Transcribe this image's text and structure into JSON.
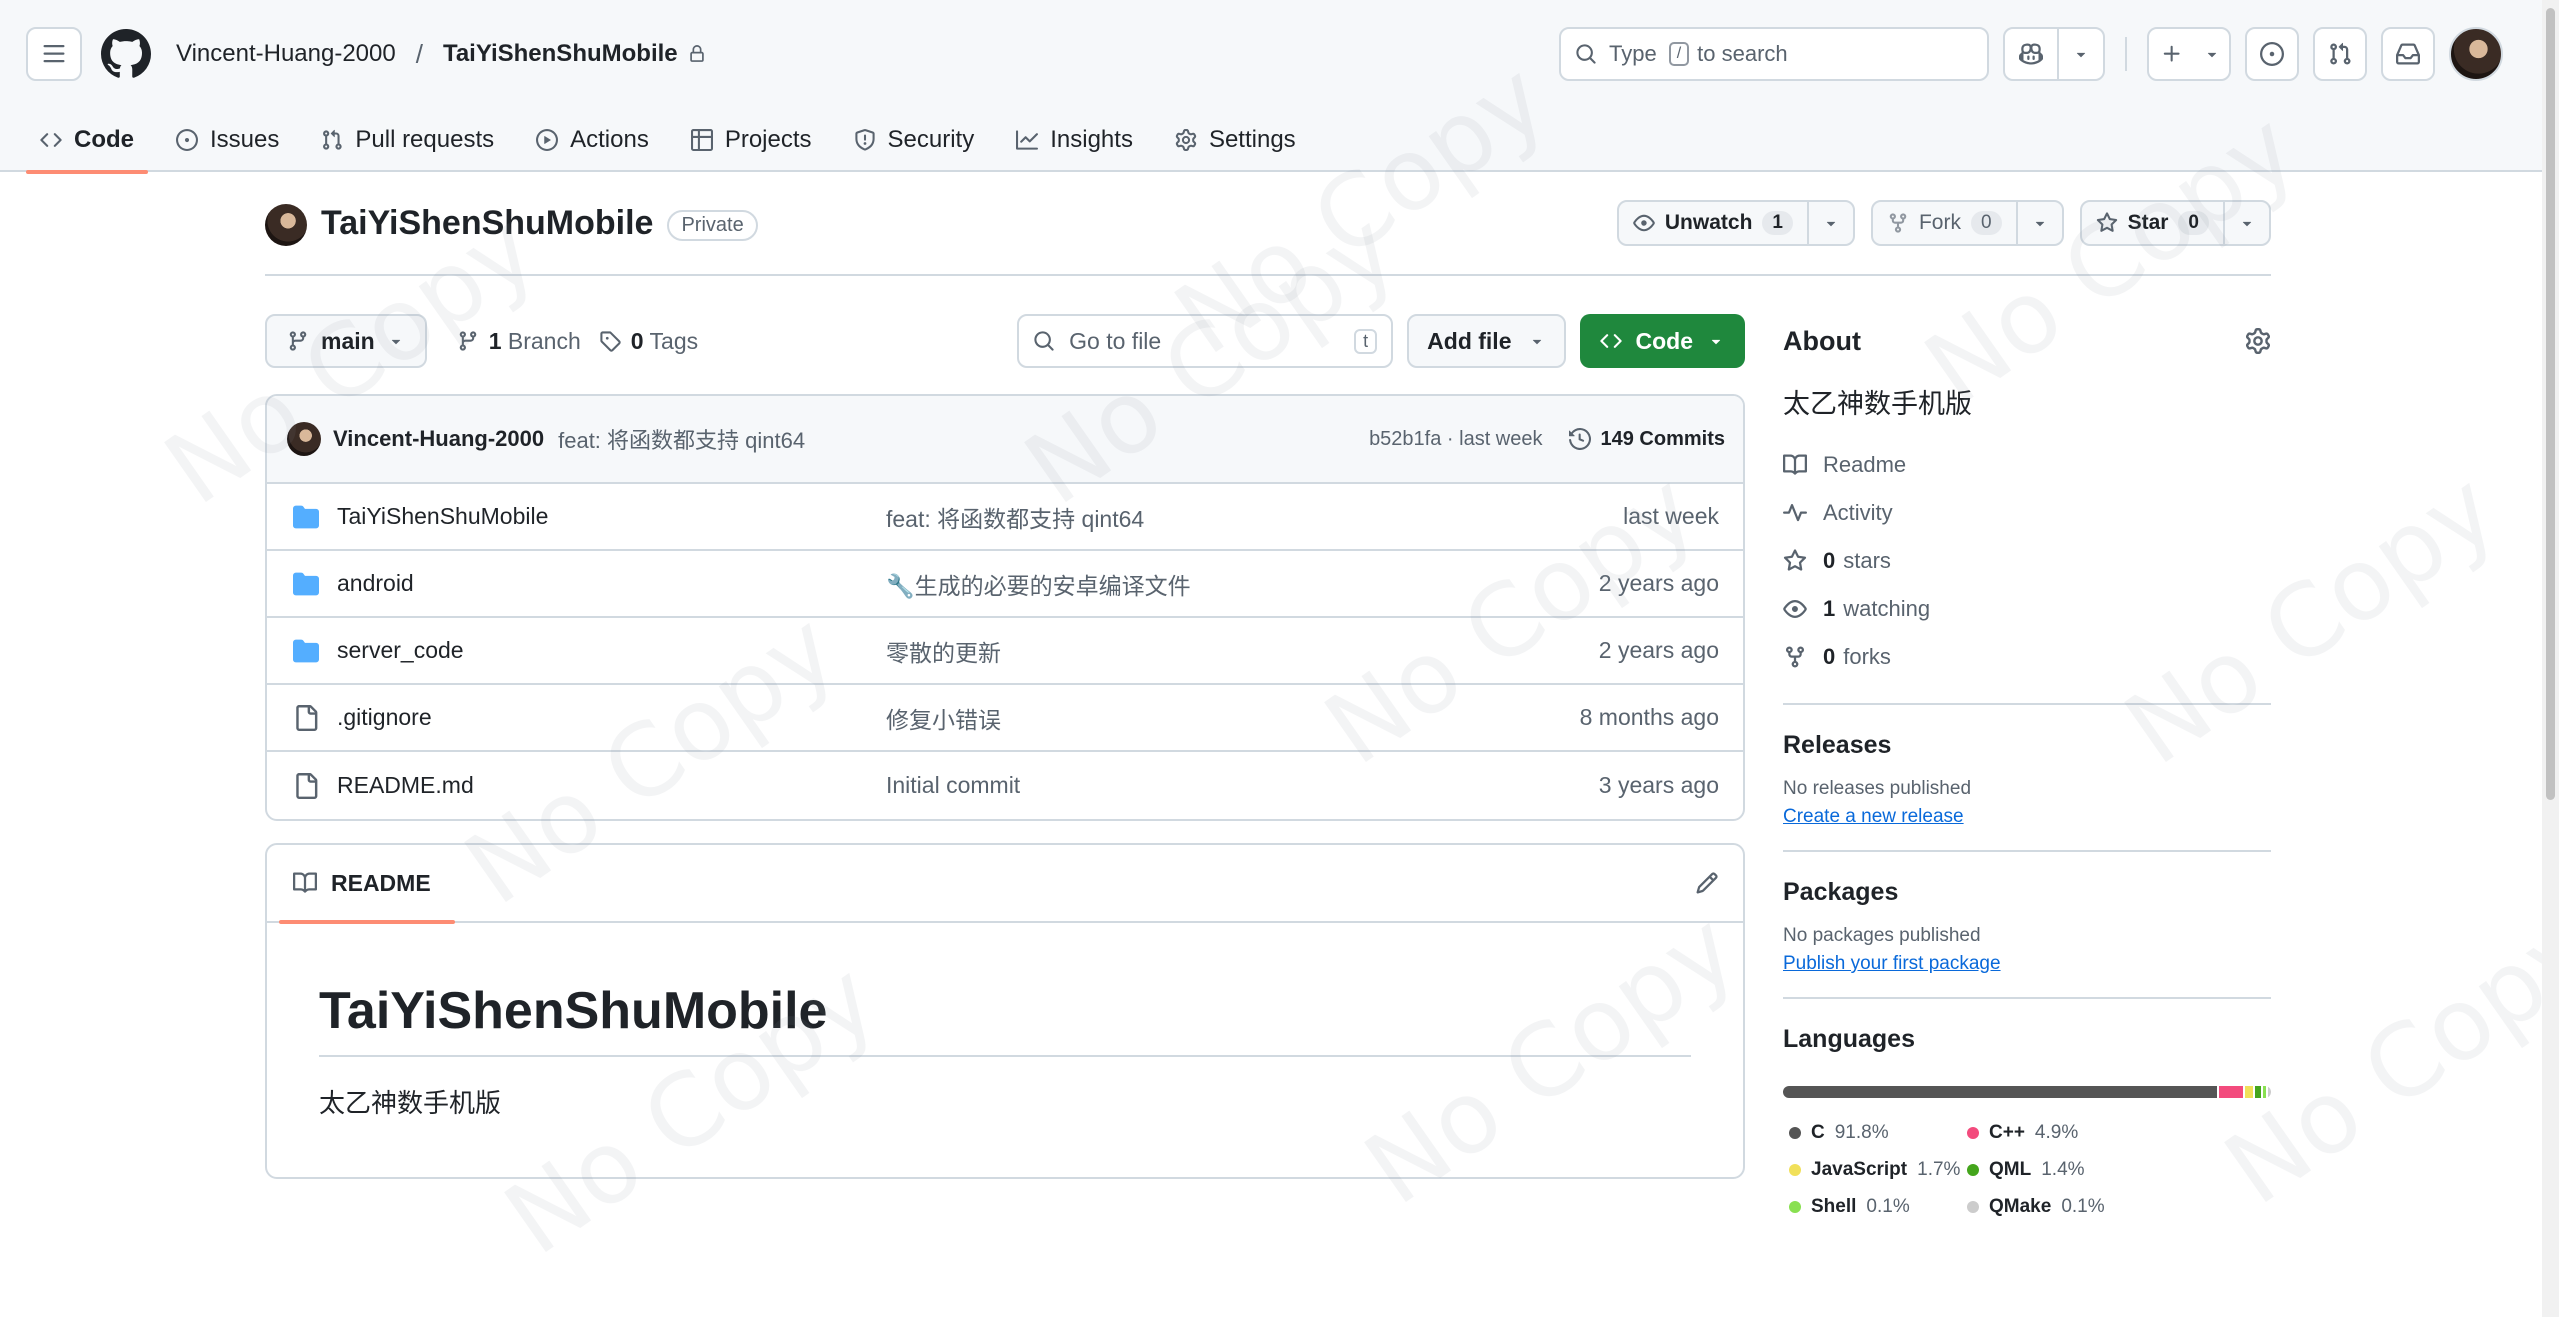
{
  "header": {
    "owner": "Vincent-Huang-2000",
    "separator": "/",
    "repo": "TaiYiShenShuMobile",
    "search": {
      "prefix": "Type",
      "key": "/",
      "suffix": "to search"
    }
  },
  "tabs": [
    {
      "label": "Code",
      "icon": "code-icon"
    },
    {
      "label": "Issues",
      "icon": "issue-icon"
    },
    {
      "label": "Pull requests",
      "icon": "pull-request-icon"
    },
    {
      "label": "Actions",
      "icon": "play-icon"
    },
    {
      "label": "Projects",
      "icon": "table-icon"
    },
    {
      "label": "Security",
      "icon": "shield-icon"
    },
    {
      "label": "Insights",
      "icon": "graph-icon"
    },
    {
      "label": "Settings",
      "icon": "gear-icon"
    }
  ],
  "repo_head": {
    "name": "TaiYiShenShuMobile",
    "visibility": "Private",
    "unwatch": {
      "label": "Unwatch",
      "count": "1"
    },
    "fork": {
      "label": "Fork",
      "count": "0"
    },
    "star": {
      "label": "Star",
      "count": "0"
    }
  },
  "filenav": {
    "branch": "main",
    "branches": "1",
    "branches_label": "Branch",
    "tags": "0",
    "tags_label": "Tags",
    "goto_placeholder": "Go to file",
    "goto_key": "t",
    "add_file": "Add file",
    "code": "Code"
  },
  "latest_commit": {
    "author": "Vincent-Huang-2000",
    "message": "feat: 将函数都支持 qint64",
    "sha_time": "b52b1fa · last week",
    "commits": "149 Commits"
  },
  "files": [
    {
      "type": "folder",
      "name": "TaiYiShenShuMobile",
      "message": "feat: 将函数都支持 qint64",
      "time": "last week"
    },
    {
      "type": "folder",
      "name": "android",
      "message": "🔧生成的必要的安卓编译文件",
      "time": "2 years ago"
    },
    {
      "type": "folder",
      "name": "server_code",
      "message": "零散的更新",
      "time": "2 years ago"
    },
    {
      "type": "file",
      "name": ".gitignore",
      "message": "修复小错误",
      "time": "8 months ago"
    },
    {
      "type": "file",
      "name": "README.md",
      "message": "Initial commit",
      "time": "3 years ago"
    }
  ],
  "readme": {
    "tab": "README",
    "title": "TaiYiShenShuMobile",
    "body": "太乙神数手机版"
  },
  "about": {
    "title": "About",
    "description": "太乙神数手机版",
    "readme": "Readme",
    "activity": "Activity",
    "stars": "0",
    "stars_label": "stars",
    "watching": "1",
    "watching_label": "watching",
    "forks": "0",
    "forks_label": "forks"
  },
  "releases": {
    "title": "Releases",
    "none": "No releases published",
    "link": "Create a new release"
  },
  "packages": {
    "title": "Packages",
    "none": "No packages published",
    "link": "Publish your first package"
  },
  "languages": {
    "title": "Languages",
    "items": [
      {
        "name": "C",
        "percent": "91.8%",
        "value": 91.8,
        "color": "#555555"
      },
      {
        "name": "C++",
        "percent": "4.9%",
        "value": 4.9,
        "color": "#f34b7d"
      },
      {
        "name": "JavaScript",
        "percent": "1.7%",
        "value": 1.7,
        "color": "#f1e05a"
      },
      {
        "name": "QML",
        "percent": "1.4%",
        "value": 1.4,
        "color": "#44a51c"
      },
      {
        "name": "Shell",
        "percent": "0.1%",
        "value": 0.1,
        "color": "#89e051"
      },
      {
        "name": "QMake",
        "percent": "0.1%",
        "value": 0.1,
        "color": "#cccccc"
      }
    ]
  },
  "watermark": "No Copy"
}
